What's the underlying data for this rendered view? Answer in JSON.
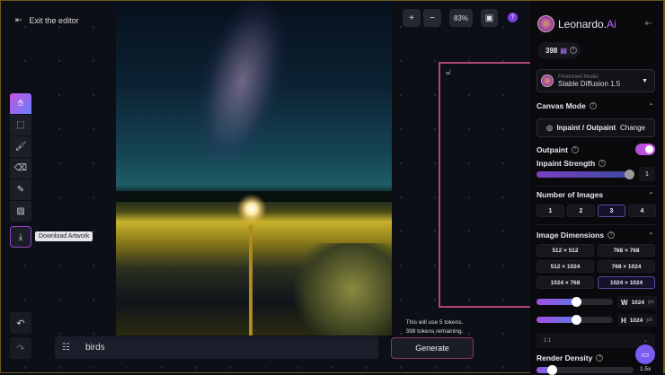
{
  "canvas": {
    "exit_label": "Exit the editor",
    "zoom_in": "+",
    "zoom_out": "−",
    "zoom_level": "83%",
    "tooltip": "Download Artwork",
    "tools": [
      "hand-icon",
      "select-icon",
      "brush-icon",
      "eraser-icon",
      "pencil-icon",
      "image-icon"
    ]
  },
  "prompt": {
    "value": "birds",
    "token_note_1": "This will use 5 tokens.",
    "token_note_2": "398 tokens remaining.",
    "generate_label": "Generate"
  },
  "sidebar": {
    "brand": "Leonardo.",
    "brand_ai": "Ai",
    "tokens": "398",
    "model": {
      "label": "Finetuned Model",
      "value": "Stable Diffusion 1.5"
    },
    "canvas_mode": {
      "title": "Canvas Mode",
      "mode": "Inpaint / Outpaint",
      "change": "Change"
    },
    "outpaint": {
      "label": "Outpaint",
      "on": true
    },
    "inpaint_strength": {
      "label": "Inpaint Strength",
      "value": "1",
      "fraction": 1.0
    },
    "num_images": {
      "title": "Number of Images",
      "options": [
        "1",
        "2",
        "3",
        "4"
      ],
      "selected": "3"
    },
    "dimensions": {
      "title": "Image Dimensions",
      "options": [
        "512 × 512",
        "768 × 768",
        "512 × 1024",
        "768 × 1024",
        "1024 × 768",
        "1024 × 1024"
      ],
      "selected": "1024 × 1024",
      "width_label": "W",
      "width": "1024",
      "height_label": "H",
      "height": "1024",
      "unit": "px",
      "ratio": "1:1"
    },
    "render_density": {
      "title": "Render Density",
      "value": "1.5x"
    }
  },
  "colors": {
    "accent": "#b36cff",
    "selection": "#b0457a"
  }
}
